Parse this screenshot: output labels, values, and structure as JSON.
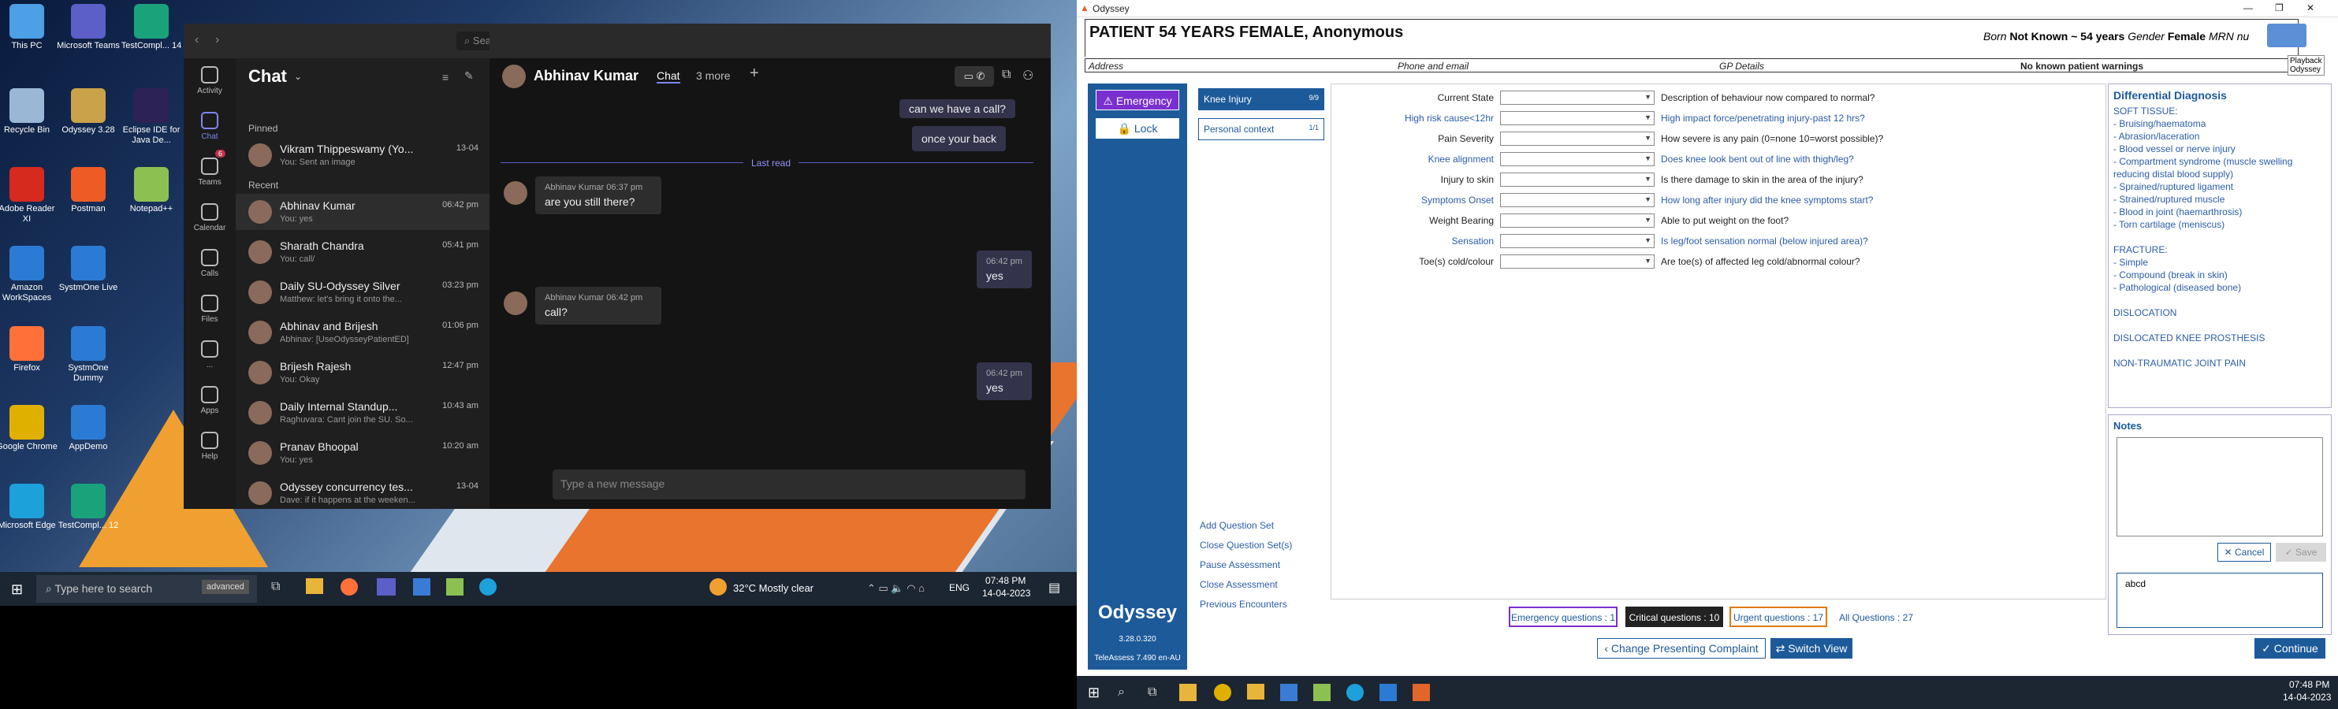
{
  "desktop": {
    "icons": [
      {
        "label": "This PC",
        "color": "#4d9fe6"
      },
      {
        "label": "Microsoft Teams",
        "color": "#5b5fc7"
      },
      {
        "label": "TestCompl... 14",
        "color": "#1aa37a"
      },
      {
        "label": "Recycle Bin",
        "color": "#9bb7d6"
      },
      {
        "label": "Odyssey 3.28",
        "color": "#c9a24a"
      },
      {
        "label": "Eclipse IDE for Java De...",
        "color": "#2c2255"
      },
      {
        "label": "Adobe Reader XI",
        "color": "#d62a1f"
      },
      {
        "label": "Postman",
        "color": "#ef5b25"
      },
      {
        "label": "Notepad++",
        "color": "#8cc152"
      },
      {
        "label": "Amazon WorkSpaces",
        "color": "#2b7bd4"
      },
      {
        "label": "SystmOne Live",
        "color": "#2b7bd4"
      },
      {
        "label": "Firefox",
        "color": "#ff7139"
      },
      {
        "label": "SystmOne Dummy",
        "color": "#2b7bd4"
      },
      {
        "label": "Google Chrome",
        "color": "#e0b000"
      },
      {
        "label": "AppDemo",
        "color": "#2b7bd4"
      },
      {
        "label": "Microsoft Edge",
        "color": "#1ca1db"
      },
      {
        "label": "TestCompl... 12",
        "color": "#1aa37a"
      }
    ]
  },
  "teams": {
    "search_placeholder": "Search",
    "rail": [
      "Activity",
      "Chat",
      "Teams",
      "Calendar",
      "Calls",
      "Files",
      "...",
      "Apps",
      "Help"
    ],
    "teams_badge": "6",
    "chat_title": "Chat",
    "pinned_label": "Pinned",
    "recent_label": "Recent",
    "pinned": [
      {
        "name": "Vikram Thippeswamy (Yo...",
        "sub": "You: Sent an image",
        "time": "13-04"
      }
    ],
    "recent": [
      {
        "name": "Abhinav Kumar",
        "sub": "You: yes",
        "time": "06:42 pm"
      },
      {
        "name": "Sharath Chandra",
        "sub": "You: call/",
        "time": "05:41 pm"
      },
      {
        "name": "Daily SU-Odyssey Silver",
        "sub": "Matthew: let's bring it onto the...",
        "time": "03:23 pm"
      },
      {
        "name": "Abhinav and Brijesh",
        "sub": "Abhinav: [UseOdysseyPatientED]",
        "time": "01:06 pm"
      },
      {
        "name": "Brijesh Rajesh",
        "sub": "You: Okay",
        "time": "12:47 pm"
      },
      {
        "name": "Daily Internal Standup...",
        "sub": "Raghuvara: Cant join the SU. So...",
        "time": "10:43 am"
      },
      {
        "name": "Pranav Bhoopal",
        "sub": "You: yes",
        "time": "10:20 am"
      },
      {
        "name": "Odyssey concurrency tes...",
        "sub": "Dave: if it happens at the weeken...",
        "time": "13-04"
      }
    ],
    "conv_name": "Abhinav Kumar",
    "conv_tab": "Chat",
    "conv_more": "3 more",
    "last_read": "Last read",
    "msg_prev1": "can we have a call?",
    "msg_prev2": "once your back",
    "msgs": [
      {
        "who": "Abhinav Kumar",
        "time": "06:37 pm",
        "text": "are you still there?"
      },
      {
        "who": "",
        "time": "06:42 pm",
        "text": "yes"
      },
      {
        "who": "Abhinav Kumar",
        "time": "06:42 pm",
        "text": "call?"
      },
      {
        "who": "",
        "time": "06:42 pm",
        "text": "yes"
      }
    ],
    "compose_placeholder": "Type a new message"
  },
  "taskbar1": {
    "search": "Type here to search",
    "tag": "advanced",
    "weather": "32°C  Mostly clear",
    "lang": "ENG",
    "time": "07:48 PM",
    "date": "14-04-2023"
  },
  "odyssey": {
    "title": "Odyssey",
    "patient": "PATIENT 54 YEARS FEMALE, Anonymous",
    "born_lbl": "Born",
    "born": "Not Known ~ 54 years",
    "gender_lbl": "Gender",
    "gender": "Female",
    "mrn": "MRN nu",
    "address": "Address",
    "phone": "Phone and email",
    "gp": "GP Details",
    "warnings": "No known patient warnings",
    "playback": "Playback",
    "playback2": "Odyssey",
    "emergency": "Emergency",
    "lock": "Lock",
    "tabs": [
      {
        "label": "Knee Injury",
        "count": "9/9"
      },
      {
        "label": "Personal context",
        "count": "1/1"
      }
    ],
    "rows": [
      {
        "lab": "Current State",
        "blue": false,
        "q": "Description of behaviour now compared to normal?"
      },
      {
        "lab": "High risk cause<12hr",
        "blue": true,
        "q": "High impact force/penetrating injury-past 12 hrs?"
      },
      {
        "lab": "Pain Severity",
        "blue": false,
        "q": "How severe is any pain (0=none 10=worst possible)?"
      },
      {
        "lab": "Knee alignment",
        "blue": true,
        "q": "Does knee look bent out of line with thigh/leg?"
      },
      {
        "lab": "Injury to skin",
        "blue": false,
        "q": "Is there damage to skin in the area of the injury?"
      },
      {
        "lab": "Symptoms Onset",
        "blue": true,
        "q": "How long after injury did the knee symptoms start?"
      },
      {
        "lab": "Weight Bearing",
        "blue": false,
        "q": "Able to put weight on the foot?"
      },
      {
        "lab": "Sensation",
        "blue": true,
        "q": "Is leg/foot sensation normal (below injured area)?"
      },
      {
        "lab": "Toe(s) cold/colour",
        "blue": false,
        "q": "Are toe(s) of affected leg cold/abnormal colour?"
      }
    ],
    "diff_title": "Differential Diagnosis",
    "diff_lines": [
      "SOFT TISSUE:",
      "- Bruising/haematoma",
      "- Abrasion/laceration",
      "- Blood vessel or nerve injury",
      "- Compartment syndrome (muscle swelling reducing distal blood supply)",
      "- Sprained/ruptured ligament",
      "- Strained/ruptured muscle",
      "- Blood in joint (haemarthrosis)",
      "- Torn cartilage (meniscus)",
      "",
      "FRACTURE:",
      "- Simple",
      "- Compound (break in skin)",
      "- Pathological (diseased bone)",
      "",
      "DISLOCATION",
      "",
      "DISLOCATED KNEE PROSTHESIS",
      "",
      "NON-TRAUMATIC JOINT PAIN"
    ],
    "notes_title": "Notes",
    "cancel": "Cancel",
    "save": "Save",
    "notes_text": "abcd",
    "links": [
      "Add Question Set",
      "Close Question Set(s)",
      "Pause Assessment",
      "Close Assessment",
      "Previous Encounters"
    ],
    "logo": "Odyssey",
    "version": "3.28.0.320",
    "teleassess": "TeleAssess 7.490 en-AU",
    "counts": [
      {
        "label": "Emergency questions : 1",
        "c": "#7a2fd0"
      },
      {
        "label": "Critical questions : 10",
        "c": "#222"
      },
      {
        "label": "Urgent questions : 17",
        "c": "#e07a10"
      },
      {
        "label": "All Questions : 27",
        "c": "#fff"
      }
    ],
    "change": "Change Presenting Complaint",
    "switch": "Switch View",
    "continue": "Continue"
  },
  "taskbar2": {
    "time": "07:48 PM",
    "date": "14-04-2023"
  }
}
